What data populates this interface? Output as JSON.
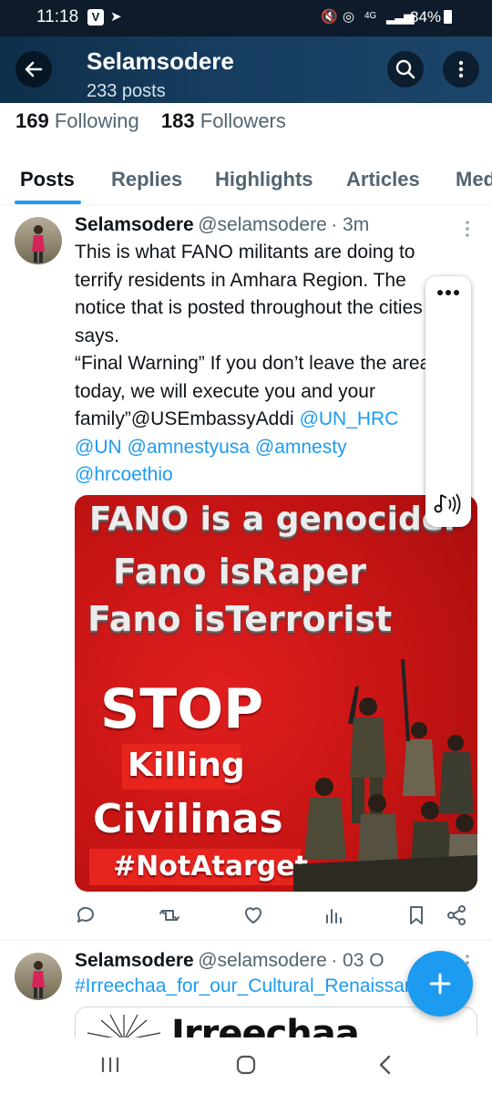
{
  "status_bar": {
    "time": "11:18",
    "network": "4G",
    "battery": "84%"
  },
  "header": {
    "title": "Selamsodere",
    "posts_count": "233 posts"
  },
  "profile": {
    "following_count": "169",
    "following_label": "Following",
    "followers_count": "183",
    "followers_label": "Followers"
  },
  "tabs": [
    {
      "label": "Posts",
      "active": true
    },
    {
      "label": "Replies"
    },
    {
      "label": "Highlights"
    },
    {
      "label": "Articles"
    },
    {
      "label": "Media"
    }
  ],
  "posts": [
    {
      "name": "Selamsodere",
      "handle": "@selamsodere",
      "time": "· 3m",
      "lines": [
        "This is what FANO militants are doing to",
        "terrify residents in Amhara Region. The",
        "notice that is posted throughout the cities",
        "says.",
        "“Final Warning” If you don’t leave the area",
        "today, we will execute you and your",
        "family”@USEmbassyAddi"
      ],
      "mentions": [
        "@UN_HRC",
        "@UN",
        "@amnestyusa",
        "@amnesty",
        "@hrcoethio"
      ],
      "image_text": {
        "line1": "FANO is a genocider",
        "line2": "Fano isRaper",
        "line3": "Fano isTerrorist",
        "stop": "STOP",
        "killing": "Killing",
        "civilinas": "Civilinas",
        "hashtag": "#NotAtarget"
      }
    },
    {
      "name": "Selamsodere",
      "handle": "@selamsodere",
      "time": "· 03 O",
      "hashtag": "#Irreechaa_for_our_Cultural_Renaissance",
      "preview_text": "Irreechaa"
    }
  ],
  "colors": {
    "accent": "#1d9bf0",
    "header_bg": "#163d60",
    "poster_red": "#c71414"
  }
}
